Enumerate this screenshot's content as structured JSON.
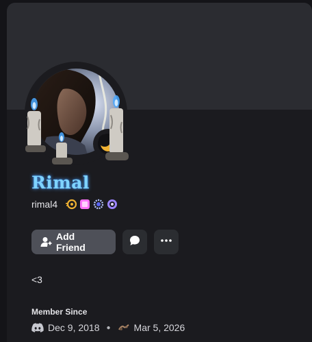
{
  "profile": {
    "display_name": "Rimal",
    "username": "rimal4",
    "bio": "<3",
    "status": "idle"
  },
  "badges": [
    {
      "icon": "nitro-badge-icon",
      "color": "#f0b232"
    },
    {
      "icon": "boost-badge-icon",
      "color": "#ff73fa"
    },
    {
      "icon": "hypesquad-badge-icon",
      "color": "#b8c7ff"
    },
    {
      "icon": "quest-badge-icon",
      "color": "#9b84ff"
    }
  ],
  "actions": {
    "add_friend_label": "Add Friend",
    "message_icon": "chat-bubble-icon",
    "more_icon": "more-dots-icon"
  },
  "member_since": {
    "title": "Member Since",
    "discord_date": "Dec 9, 2018",
    "server_date": "Mar 5, 2026"
  },
  "colors": {
    "card_bg": "#1b1b1f",
    "banner": "#2b2c31",
    "name_glow": "#7fd3ff",
    "status_idle": "#f0b232"
  }
}
